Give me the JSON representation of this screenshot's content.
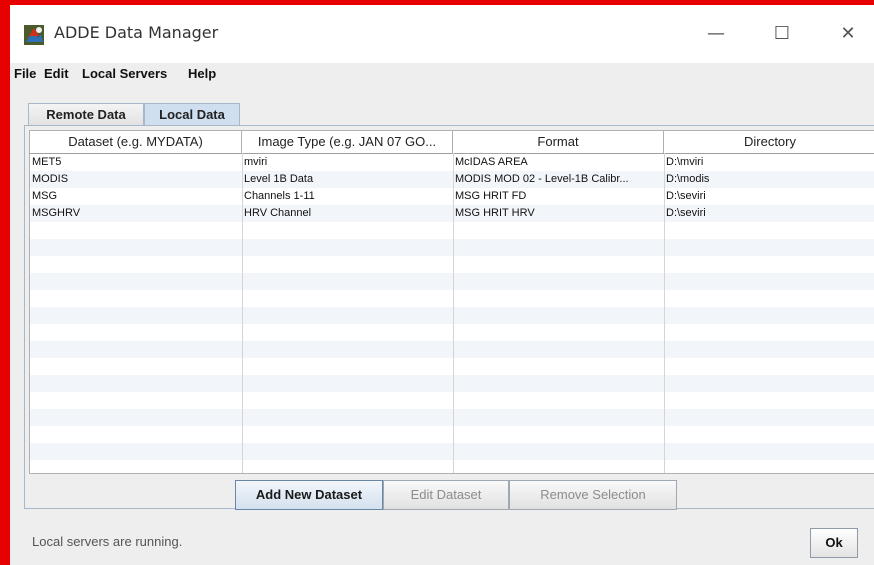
{
  "window": {
    "title": "ADDE Data Manager",
    "minimize_glyph": "—",
    "maximize_glyph": "☐",
    "close_glyph": "✕",
    "icon": "adde-app-icon"
  },
  "menu": [
    "File",
    "Edit",
    "Local Servers",
    "Help"
  ],
  "tabs": [
    {
      "label": "Remote Data",
      "selected": false
    },
    {
      "label": "Local Data",
      "selected": true
    }
  ],
  "table": {
    "columns": [
      "Dataset (e.g. MYDATA)",
      "Image Type (e.g. JAN 07 GO...",
      "Format",
      "Directory"
    ],
    "rows": [
      [
        "MET5",
        "mviri",
        "McIDAS AREA",
        "D:\\mviri"
      ],
      [
        "MODIS",
        "Level 1B Data",
        "MODIS MOD 02 - Level-1B Calibr...",
        "D:\\modis"
      ],
      [
        "MSG",
        "Channels 1-11",
        "MSG HRIT FD",
        "D:\\seviri"
      ],
      [
        "MSGHRV",
        "HRV Channel",
        "MSG HRIT HRV",
        "D:\\seviri"
      ]
    ]
  },
  "buttons": {
    "add": "Add New Dataset",
    "edit": "Edit Dataset",
    "remove": "Remove Selection",
    "ok": "Ok"
  },
  "status": "Local servers are running.",
  "colors": {
    "frame": "#e60000",
    "selected_tab": "#cfdff0",
    "panel_bg": "#eeeeee"
  }
}
